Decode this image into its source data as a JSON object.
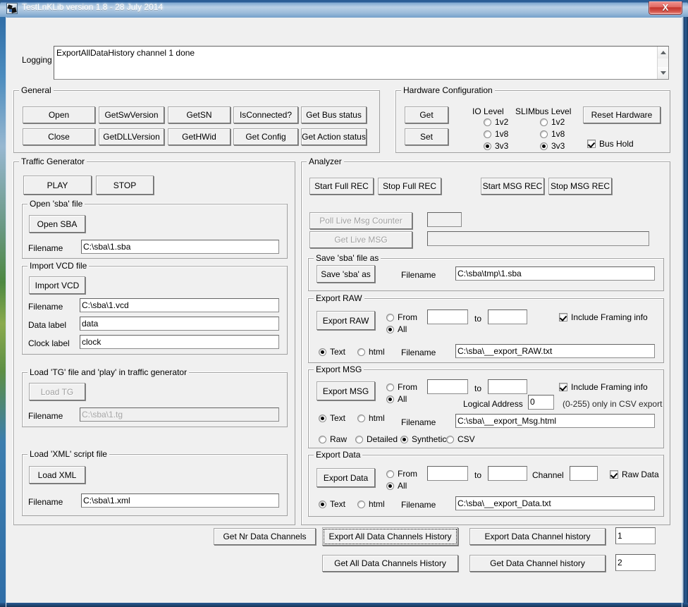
{
  "window": {
    "title": "TestLnKLib version 1.8 - 28 July  2014",
    "close_label": "X",
    "icon": "app-icon"
  },
  "logging": {
    "label": "Logging",
    "value": "ExportAllDataHistory channel 1 done"
  },
  "general": {
    "legend": "General",
    "buttons_row1": [
      "Open",
      "GetSwVersion",
      "GetSN",
      "IsConnected?",
      "Get Bus status"
    ],
    "buttons_row2": [
      "Close",
      "GetDLLVersion",
      "GetHWid",
      "Get Config",
      "Get Action status"
    ]
  },
  "hardware": {
    "legend": "Hardware Configuration",
    "get_label": "Get",
    "set_label": "Set",
    "io_level_label": "IO Level",
    "slimbus_level_label": "SLIMbus Level",
    "levels": [
      "1v2",
      "1v8",
      "3v3"
    ],
    "io_level_selected": "3v3",
    "slimbus_level_selected": "3v3",
    "reset_label": "Reset Hardware",
    "bus_hold_label": "Bus Hold",
    "bus_hold_checked": true
  },
  "traffic": {
    "legend": "Traffic Generator",
    "play_label": "PLAY",
    "stop_label": "STOP",
    "open_sba": {
      "legend": "Open 'sba' file",
      "button_label": "Open SBA",
      "filename_label": "Filename",
      "filename_value": "C:\\sba\\1.sba"
    },
    "import_vcd": {
      "legend": "Import VCD file",
      "button_label": "Import VCD",
      "filename_label": "Filename",
      "filename_value": "C:\\sba\\1.vcd",
      "data_label_label": "Data label",
      "data_label_value": "data",
      "clock_label_label": "Clock label",
      "clock_label_value": "clock"
    },
    "load_tg": {
      "legend": "Load 'TG' file and 'play' in traffic generator",
      "button_label": "Load TG",
      "button_disabled": true,
      "filename_label": "Filename",
      "filename_value": "C:\\sba\\1.tg",
      "filename_disabled": true
    },
    "load_xml": {
      "legend": "Load 'XML' script file",
      "button_label": "Load XML",
      "filename_label": "Filename",
      "filename_value": "C:\\sba\\1.xml"
    }
  },
  "analyzer": {
    "legend": "Analyzer",
    "start_full_rec": "Start Full REC",
    "stop_full_rec": "Stop Full REC",
    "start_msg_rec": "Start MSG REC",
    "stop_msg_rec": "Stop MSG REC",
    "poll_live_msg_counter": "Poll Live Msg Counter",
    "poll_live_msg_counter_disabled": true,
    "poll_counter_value": "",
    "get_live_msg": "Get Live MSG",
    "get_live_msg_disabled": true,
    "live_msg_value": "",
    "save_sba": {
      "legend": "Save 'sba' file as",
      "button_label": "Save 'sba' as",
      "filename_label": "Filename",
      "filename_value": "C:\\sba\\tmp\\1.sba"
    },
    "export_raw": {
      "legend": "Export RAW",
      "button_label": "Export RAW",
      "from_label": "From",
      "from_value": "",
      "to_label": "to",
      "to_value": "",
      "all_label": "All",
      "range_selected": "All",
      "include_framing_label": "Include Framing info",
      "include_framing_checked": true,
      "text_label": "Text",
      "html_label": "html",
      "format_selected": "Text",
      "filename_label": "Filename",
      "filename_value": "C:\\sba\\__export_RAW.txt"
    },
    "export_msg": {
      "legend": "Export MSG",
      "button_label": "Export MSG",
      "from_label": "From",
      "from_value": "",
      "to_label": "to",
      "to_value": "",
      "all_label": "All",
      "range_selected": "All",
      "include_framing_label": "Include Framing info",
      "include_framing_checked": true,
      "logical_address_label": "Logical Address",
      "logical_address_value": "0",
      "logical_address_hint": "(0-255) only in CSV export",
      "text_label": "Text",
      "html_label": "html",
      "format_selected": "Text",
      "filename_label": "Filename",
      "filename_value": "C:\\sba\\__export_Msg.html",
      "detail_options": [
        "Raw",
        "Detailed",
        "Synthetic",
        "CSV"
      ],
      "detail_selected": "Synthetic"
    },
    "export_data": {
      "legend": "Export Data",
      "button_label": "Export Data",
      "from_label": "From",
      "from_value": "",
      "to_label": "to",
      "to_value": "",
      "all_label": "All",
      "range_selected": "All",
      "channel_label": "Channel",
      "channel_value": "",
      "raw_data_label": "Raw Data",
      "raw_data_checked": true,
      "text_label": "Text",
      "html_label": "html",
      "format_selected": "Text",
      "filename_label": "Filename",
      "filename_value": "C:\\sba\\__export_Data.txt"
    }
  },
  "bottom": {
    "get_nr_data_channels": "Get Nr Data Channels",
    "export_all_data_channels_history": "Export All Data Channels History",
    "get_all_data_channels_history": "Get All Data Channels History",
    "export_data_channel_history": "Export Data Channel history",
    "get_data_channel_history": "Get Data Channel history",
    "export_channel_value": "1",
    "get_channel_value": "2"
  }
}
